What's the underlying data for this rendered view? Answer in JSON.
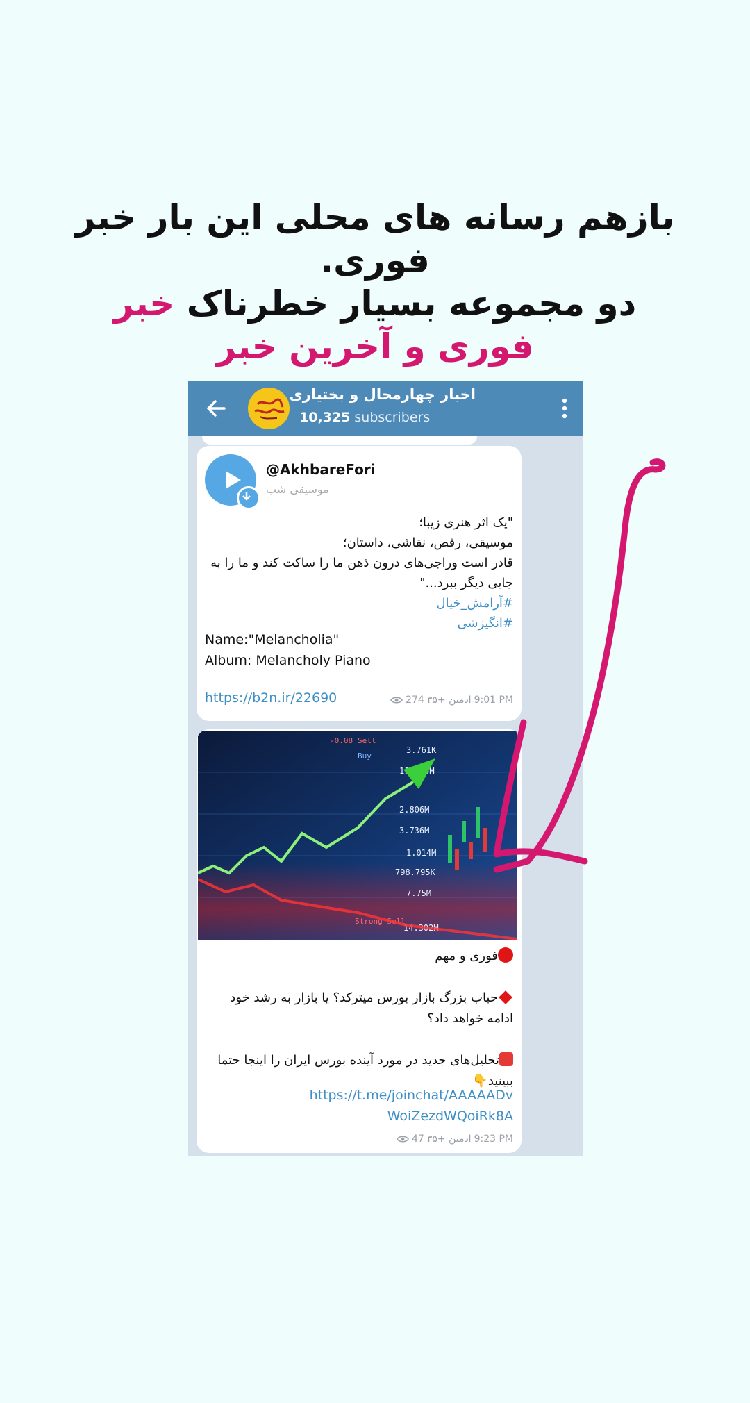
{
  "headline": {
    "line1": "بازهم رسانه های محلی این بار خبر فوری.",
    "line2_main": "دو مجموعه بسیار خطرناک",
    "line2_accent": "خبر فوری و آخرین خبر"
  },
  "channel": {
    "title": "اخبار چهارمحال و بختیاری",
    "subscriber_count": "10,325",
    "subscriber_label": "subscribers"
  },
  "music_post": {
    "performer": "@AkhbareFori",
    "subtitle": "موسیقی شب",
    "poem_line1": "\"یک اثر هنری زیبا؛",
    "poem_line2": "موسیقی، رقص، نقاشی، داستان؛",
    "poem_line3": "قادر است وراجی‌های درون ذهن ما را ساکت کند و ما را به جایی دیگر ببرد...\"",
    "tag1": "#آرامش_خیال",
    "tag2": "#انگیزشی",
    "name_line": "Name:\"Melancholia\"",
    "album_line": "Album: Melancholy Piano",
    "link": "https://b2n.ir/22690",
    "views": "274",
    "author": "ادمین +۳۵",
    "time": "9:01 PM"
  },
  "news_post": {
    "line1": "فوری و مهم",
    "line2": "حباب بزرگ بازار بورس میترکد؟ یا بازار به رشد خود ادامه خواهد داد؟",
    "line3": "تحلیل‌های جدید در مورد آینده بورس ایران را اینجا حتما ببینید",
    "link": "https://t.me/joinchat/AAAAADvWoiZezdWQoiRk8A",
    "views": "47",
    "author": "ادمین +۳۵",
    "time": "9:23 PM",
    "image_numbers": [
      "-0.08",
      "Sell",
      "3.761K",
      "Buy",
      "11.525M",
      "2.806M",
      "3.736M",
      "1.014M",
      "798.795K",
      "7.75M",
      "14.302M",
      "Strong Sell"
    ]
  },
  "colors": {
    "accent": "#d4176f",
    "appbar": "#4e8ab8",
    "link": "#3e8fc6"
  }
}
